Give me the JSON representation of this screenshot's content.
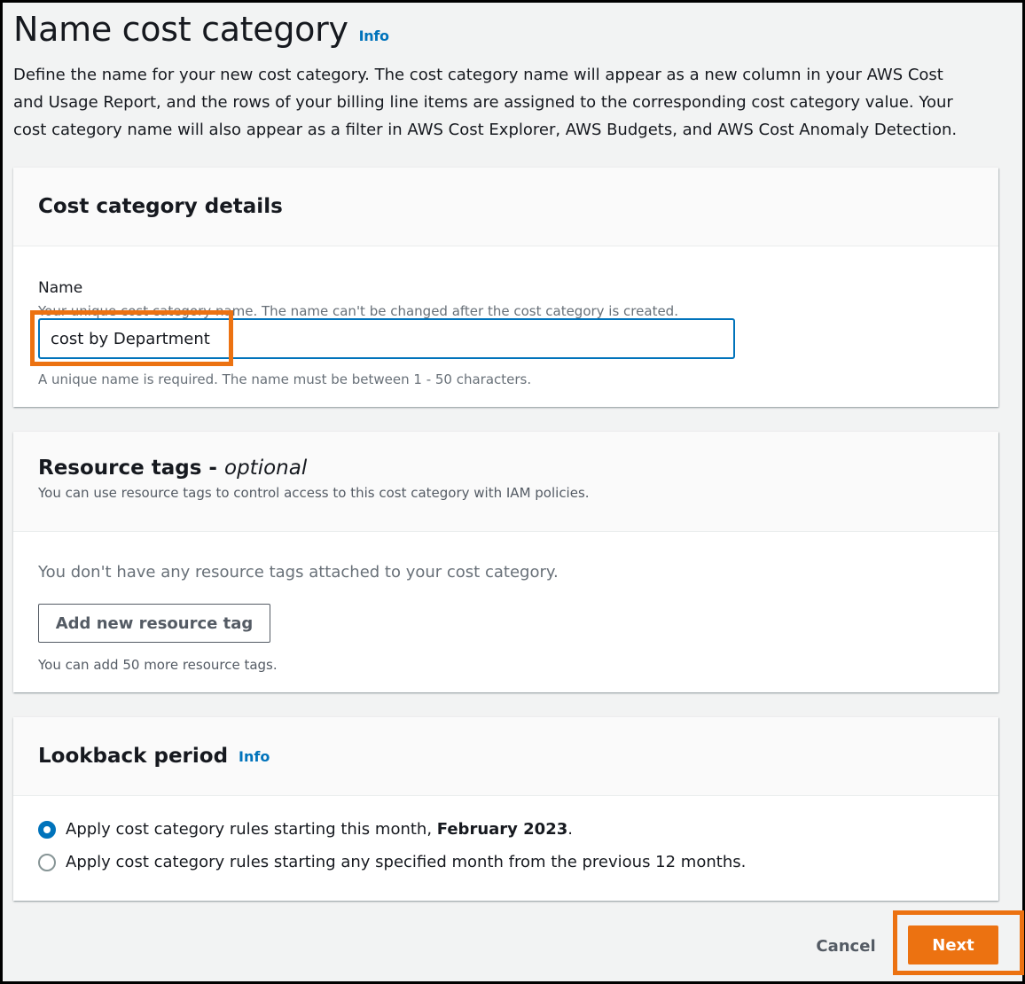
{
  "page": {
    "title": "Name cost category",
    "info_label": "Info",
    "description": "Define the name for your new cost category. The cost category name will appear as a new column in your AWS Cost and Usage Report, and the rows of your billing line items are assigned to the corresponding cost category value. Your cost category name will also appear as a filter in AWS Cost Explorer, AWS Budgets, and AWS Cost Anomaly Detection."
  },
  "details": {
    "title": "Cost category details",
    "name_label": "Name",
    "name_description": "Your unique cost category name. The name can't be changed after the cost category is created.",
    "name_value": "cost by Department",
    "name_hint": "A unique name is required. The name must be between 1 - 50 characters."
  },
  "tags": {
    "title": "Resource tags - ",
    "title_optional": "optional",
    "subtitle": "You can use resource tags to control access to this cost category with IAM policies.",
    "empty_message": "You don't have any resource tags attached to your cost category.",
    "add_button": "Add new resource tag",
    "limit_text": "You can add 50 more resource tags."
  },
  "lookback": {
    "title": "Lookback period",
    "info_label": "Info",
    "option1_text": "Apply cost category rules starting this month, ",
    "option1_month": "February 2023",
    "option1_suffix": ".",
    "option1_selected": true,
    "option2_text": "Apply cost category rules starting any specified month from the previous 12 months.",
    "option2_selected": false
  },
  "footer": {
    "cancel_label": "Cancel",
    "next_label": "Next"
  },
  "colors": {
    "accent": "#0073bb",
    "primary_button": "#ec7211",
    "highlight": "#ec7211"
  }
}
